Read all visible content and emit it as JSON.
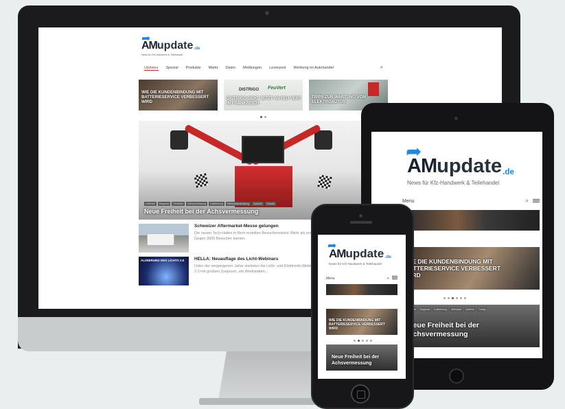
{
  "site": {
    "logo_main": "AM",
    "logo_rest": "update",
    "logo_tld": ".de",
    "tagline": "News für Kfz-Handwerk & Teilehandel"
  },
  "desktop": {
    "nav": [
      "Updates",
      "Spezial",
      "Produkte",
      "Markt",
      "Daten",
      "Meldungen",
      "Leserpost",
      "Werbung im Autohandel"
    ],
    "tiles": [
      {
        "caption": "Wie die Kundenbindung mit Batterieservice verbessert wird"
      },
      {
        "caption": "Distrigo geht jetzt an Feu Vert in Frankreich",
        "brand1": "DISTRIGO",
        "brand2": "FeuVert"
      },
      {
        "caption": "Tipps zur Wartung von Elektroautos"
      }
    ],
    "hero_title": "Neue Freiheit bei der Achsvermessung",
    "hero_tags": [
      "Lieferant",
      "Diagnose",
      "Hersteller",
      "Achsvermessung",
      "Kalibrierung",
      "Werkstattausrüstung",
      "Zubehör",
      "Technik"
    ],
    "posts": [
      {
        "title": "Schweizer Aftermarket-Messe gelungen",
        "excerpt": "Die neuen Tech-Hallen in Bern erzielten Besucherrekord. Mehr als erwartet: Gegen 3000 Besucher kamen."
      },
      {
        "title": "HELLA: Neuauflage des Licht-Webinars",
        "excerpt": "Unter der vergangenen Jahre starteten die Licht- und Elektronik-Webinare 1.0 / 2.0 mit großem Zuspruch, um Werkstätten...",
        "thumb_text": "ALISIERUNG DES LICHTS 2.0"
      }
    ],
    "search_icon": "search-icon"
  },
  "tablet": {
    "menu_label": "Menu",
    "slide_caption": "Wie die Kundenbindung mit Batterieservice verbessert wird",
    "hero_title": "Neue Freiheit bei der Achsvermessung",
    "tags": [
      "Lieferant",
      "Diagnose",
      "Kalibrierung",
      "Werkstatt",
      "Zubehör",
      "Tuning"
    ]
  },
  "phone": {
    "menu_label": "Menu",
    "slide_caption": "Wie die Kundenbindung mit Batterieservice verbessert wird",
    "hero_title": "Neue Freiheit bei der Achsvermessung"
  },
  "colors": {
    "accent": "#1e88e5",
    "nav_active": "#d32f2f",
    "device": "#1b1b1d",
    "background": "#e9eeee"
  }
}
